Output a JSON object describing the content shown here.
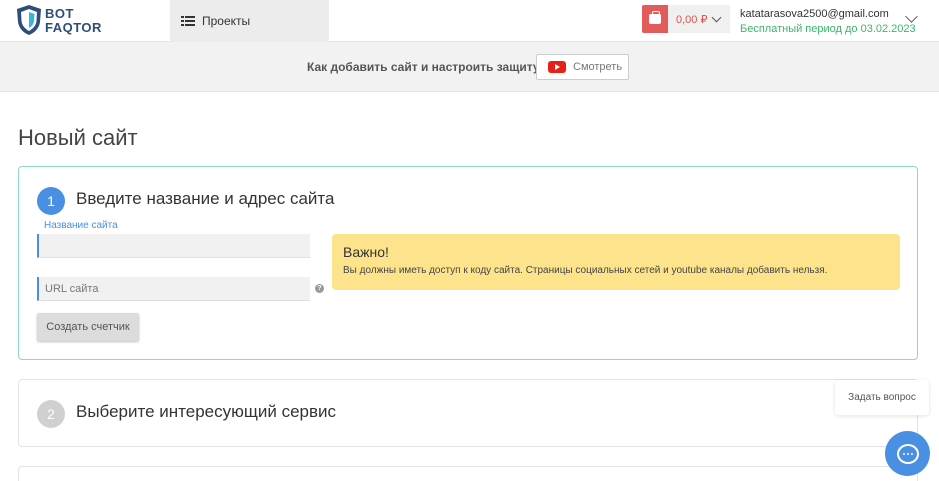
{
  "header": {
    "logo_line1": "BOT",
    "logo_line2": "FAQTOR",
    "nav_projects": "Проекты",
    "balance": "0,00 ₽",
    "email": "katatarasova2500@gmail.com",
    "trial": "Бесплатный период до 03.02.2023"
  },
  "banner": {
    "text": "Как добавить сайт и настроить защиту",
    "watch_label": "Смотреть"
  },
  "page_title": "Новый сайт",
  "step1": {
    "number": "1",
    "title": "Введите название и адрес сайта",
    "name_label": "Название сайта",
    "url_placeholder": "URL сайта",
    "create_button": "Создать счетчик",
    "notice_title": "Важно!",
    "notice_text": "Вы должны иметь доступ к коду сайта. Страницы социальных сетей и youtube каналы добавить нельзя."
  },
  "step2": {
    "number": "2",
    "title": "Выберите интересующий сервис"
  },
  "chat": {
    "ask_label": "Задать вопрос"
  },
  "colors": {
    "accent": "#4a90e2",
    "success": "#3bb56d",
    "danger": "#e25c5c",
    "notice": "#fde48c"
  }
}
